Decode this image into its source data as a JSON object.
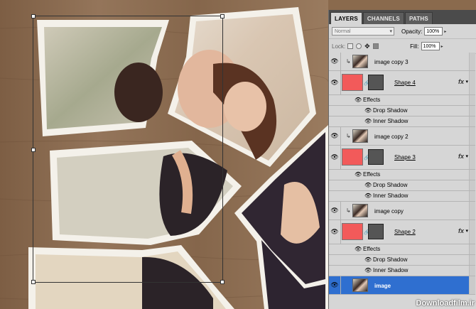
{
  "panel": {
    "tabs": [
      "LAYERS",
      "CHANNELS",
      "PATHS"
    ],
    "blend_mode": "Normal",
    "opacity_label": "Opacity:",
    "opacity_value": "100%",
    "lock_label": "Lock:",
    "fill_label": "Fill:",
    "fill_value": "100%"
  },
  "layers": [
    {
      "kind": "image",
      "name": "image copy 3",
      "clipped": true
    },
    {
      "kind": "shape",
      "name": "Shape 4",
      "fx": "fx"
    },
    {
      "kind": "sub",
      "name": "Effects"
    },
    {
      "kind": "sub",
      "name": "Drop Shadow"
    },
    {
      "kind": "sub",
      "name": "Inner Shadow"
    },
    {
      "kind": "image",
      "name": "image copy 2",
      "clipped": true
    },
    {
      "kind": "shape",
      "name": "Shape 3",
      "fx": "fx"
    },
    {
      "kind": "sub",
      "name": "Effects"
    },
    {
      "kind": "sub",
      "name": "Drop Shadow"
    },
    {
      "kind": "sub",
      "name": "Inner Shadow"
    },
    {
      "kind": "image",
      "name": "image copy",
      "clipped": true
    },
    {
      "kind": "shape",
      "name": "Shape 2",
      "fx": "fx"
    },
    {
      "kind": "sub",
      "name": "Effects"
    },
    {
      "kind": "sub",
      "name": "Drop Shadow"
    },
    {
      "kind": "sub",
      "name": "Inner Shadow"
    },
    {
      "kind": "image",
      "name": "image",
      "selected": true
    }
  ],
  "watermark": "Downloadfilm.ir",
  "colors": {
    "wood": "#8a6a4d",
    "shape_thumb": "#f25a5a",
    "selection": "#2f6fd0"
  }
}
